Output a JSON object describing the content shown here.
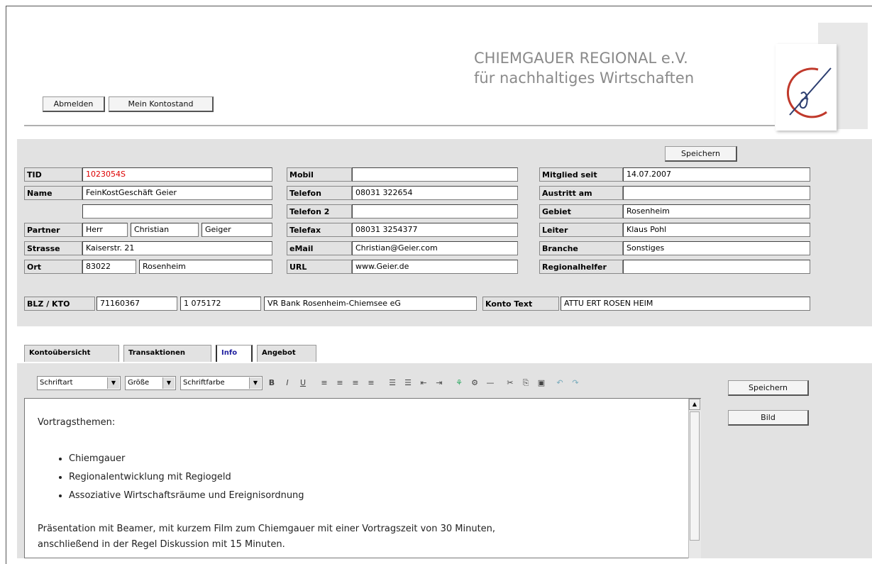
{
  "header": {
    "buttons": {
      "abmelden": "Abmelden",
      "mein_konto": "Mein Kontostand"
    },
    "logo": {
      "line1": "CHIEMGAUER REGIONAL e.V.",
      "line2": "für nachhaltiges Wirtschaften"
    }
  },
  "member": {
    "speichern_top": "Speichern",
    "tid": {
      "label": "TID",
      "value": "1023054S"
    },
    "name": {
      "label": "Name",
      "value": "FeinKostGeschäft Geier"
    },
    "name2": {
      "value": ""
    },
    "partner": {
      "label": "Partner",
      "anrede": "Herr",
      "vorname": "Christian",
      "nachname": "Geiger"
    },
    "strasse": {
      "label": "Strasse",
      "value": "Kaiserstr. 21"
    },
    "ort": {
      "label": "Ort",
      "plz": "83022",
      "value": "Rosenheim"
    },
    "mobil": {
      "label": "Mobil",
      "value": ""
    },
    "telefon": {
      "label": "Telefon",
      "value": "08031 322654"
    },
    "telefon2": {
      "label": "Telefon 2",
      "value": ""
    },
    "telefax": {
      "label": "Telefax",
      "value": "08031 3254377"
    },
    "email": {
      "label": "eMail",
      "value": "Christian@Geier.com"
    },
    "url": {
      "label": "URL",
      "value": "www.Geier.de"
    },
    "mitglied_seit": {
      "label": "Mitglied seit",
      "value": "14.07.2007"
    },
    "austritt_am": {
      "label": "Austritt am",
      "value": ""
    },
    "gebiet": {
      "label": "Gebiet",
      "value": "Rosenheim"
    },
    "leiter": {
      "label": "Leiter",
      "value": "Klaus Pohl"
    },
    "branche": {
      "label": "Branche",
      "value": "Sonstiges"
    },
    "regionalhelfer": {
      "label": "Regionalhelfer",
      "value": ""
    },
    "blz_kto": {
      "label": "BLZ / KTO",
      "blz": "71160367",
      "kto": "1 075172",
      "bank": "VR Bank Rosenheim-Chiemsee eG"
    },
    "konto_text": {
      "label": "Konto Text",
      "value": "ATTU ERT ROSEN HEIM"
    }
  },
  "tabs": [
    "Kontoübersicht",
    "Transaktionen",
    "Info",
    "Angebot"
  ],
  "editor": {
    "font_select": "Schriftart",
    "size_select": "Größe",
    "color_select": "Schriftfarbe",
    "speichern": "Speichern",
    "bild": "Bild",
    "heading": "Vortragsthemen:",
    "bullets": [
      "Chiemgauer",
      "Regionalentwicklung mit Regiogeld",
      "Assoziative Wirtschaftsräume und Ereignisordnung"
    ],
    "para_line1": "Präsentation mit Beamer, mit kurzem Film zum Chiemgauer mit einer Vortragszeit von 30 Minuten,",
    "para_line2": "anschließend in der Regel Diskussion mit 15 Minuten."
  }
}
